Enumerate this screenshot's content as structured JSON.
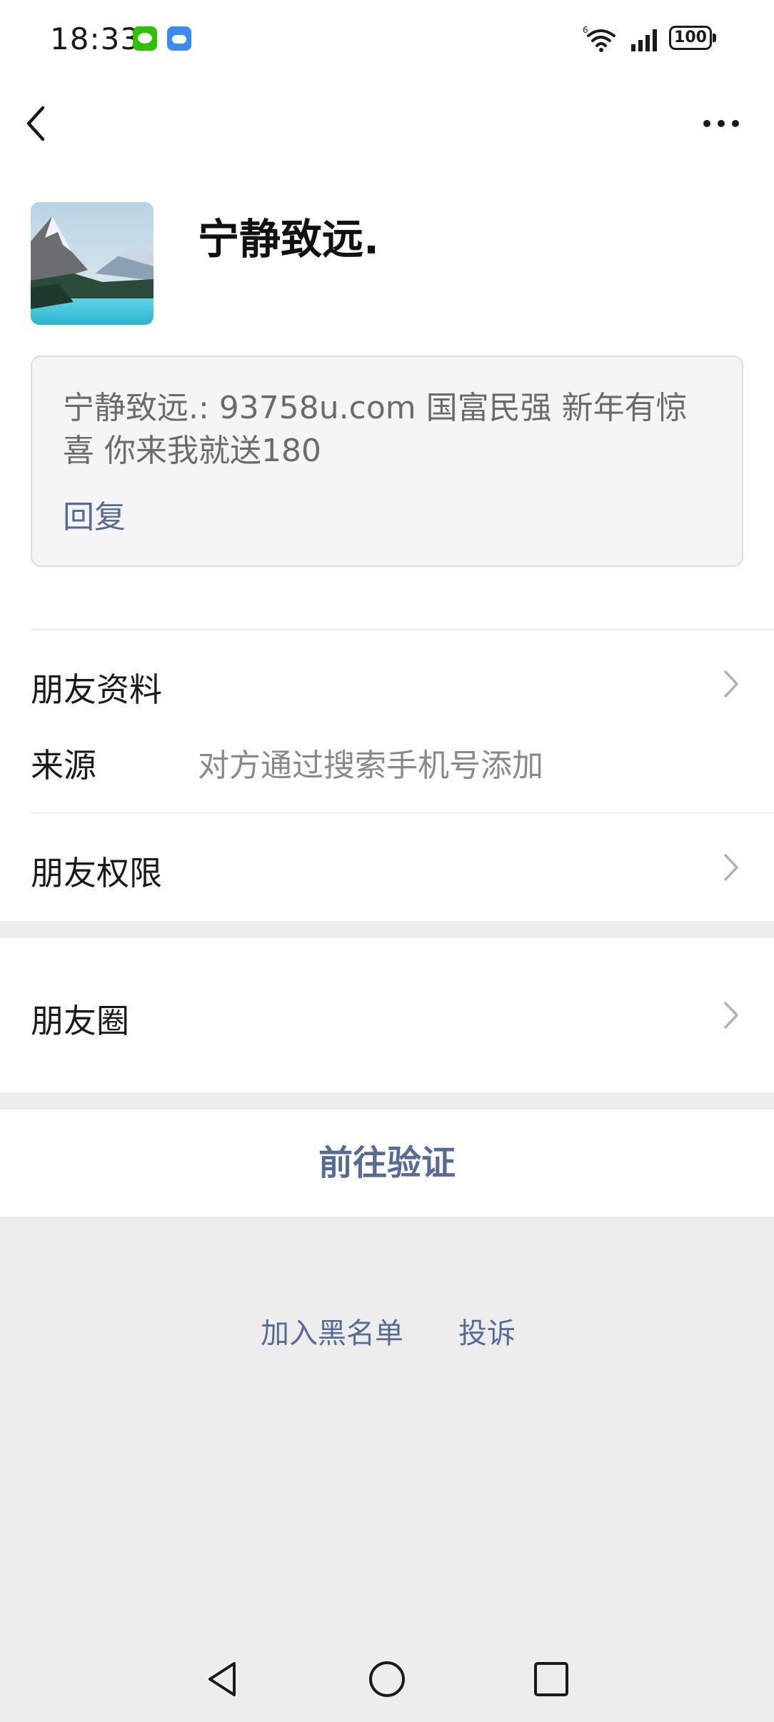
{
  "status_bar": {
    "time": "18:33",
    "battery": "100",
    "icons": [
      "wechat-notification-icon",
      "weather-notification-icon",
      "wifi-6-icon",
      "cellular-signal-icon",
      "battery-icon"
    ]
  },
  "nav": {
    "back_icon": "chevron-left-icon",
    "more_icon": "more-dots-icon"
  },
  "profile": {
    "name": "宁静致远."
  },
  "message": {
    "text": "宁静致远.: 93758u.com 国富民强 新年有惊喜 你来我就送180",
    "reply_label": "回复"
  },
  "rows": {
    "friend_info": "朋友资料",
    "source_label": "来源",
    "source_value": "对方通过搜索手机号添加",
    "friend_permissions": "朋友权限",
    "moments": "朋友圈"
  },
  "actions": {
    "verify": "前往验证",
    "blacklist": "加入黑名单",
    "report": "投诉"
  },
  "colors": {
    "link": "#576b95",
    "background": "#ededed",
    "card": "#ffffff"
  }
}
